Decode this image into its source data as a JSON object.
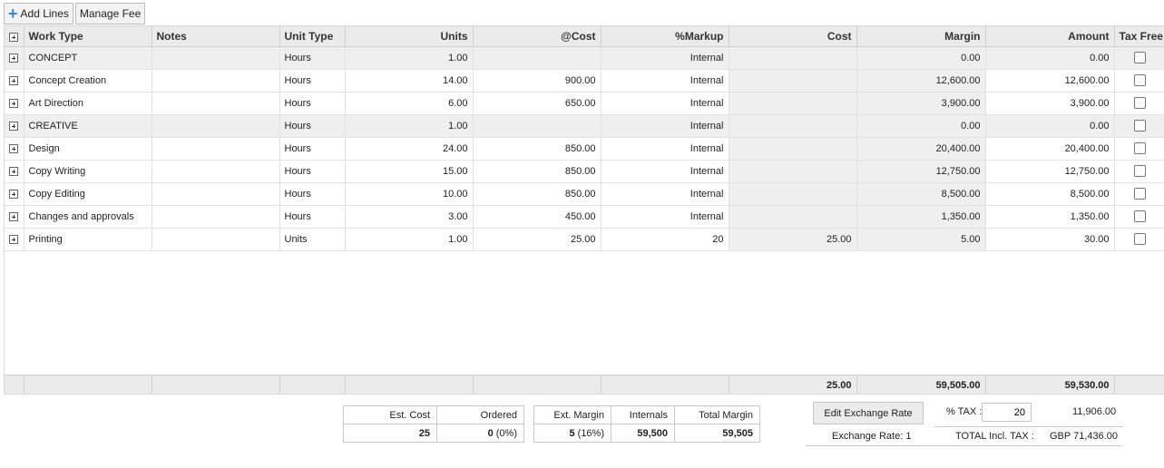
{
  "toolbar": {
    "add_lines": "Add Lines",
    "manage_fee": "Manage Fee"
  },
  "columns": [
    "Work Type",
    "Notes",
    "Unit Type",
    "Units",
    "@Cost",
    "%Markup",
    "Cost",
    "Margin",
    "Amount",
    "Tax Free"
  ],
  "rows": [
    {
      "work_type": "CONCEPT",
      "notes": "",
      "unit_type": "Hours",
      "units": "1.00",
      "at_cost": "",
      "markup": "Internal",
      "cost": "",
      "margin": "0.00",
      "amount": "0.00",
      "tax_free": false
    },
    {
      "work_type": "Concept Creation",
      "notes": "",
      "unit_type": "Hours",
      "units": "14.00",
      "at_cost": "900.00",
      "markup": "Internal",
      "cost": "",
      "margin": "12,600.00",
      "amount": "12,600.00",
      "tax_free": false
    },
    {
      "work_type": "Art Direction",
      "notes": "",
      "unit_type": "Hours",
      "units": "6.00",
      "at_cost": "650.00",
      "markup": "Internal",
      "cost": "",
      "margin": "3,900.00",
      "amount": "3,900.00",
      "tax_free": false
    },
    {
      "work_type": "CREATIVE",
      "notes": "",
      "unit_type": "Hours",
      "units": "1.00",
      "at_cost": "",
      "markup": "Internal",
      "cost": "",
      "margin": "0.00",
      "amount": "0.00",
      "tax_free": false
    },
    {
      "work_type": "Design",
      "notes": "",
      "unit_type": "Hours",
      "units": "24.00",
      "at_cost": "850.00",
      "markup": "Internal",
      "cost": "",
      "margin": "20,400.00",
      "amount": "20,400.00",
      "tax_free": false
    },
    {
      "work_type": "Copy Writing",
      "notes": "",
      "unit_type": "Hours",
      "units": "15.00",
      "at_cost": "850.00",
      "markup": "Internal",
      "cost": "",
      "margin": "12,750.00",
      "amount": "12,750.00",
      "tax_free": false
    },
    {
      "work_type": "Copy Editing",
      "notes": "",
      "unit_type": "Hours",
      "units": "10.00",
      "at_cost": "850.00",
      "markup": "Internal",
      "cost": "",
      "margin": "8,500.00",
      "amount": "8,500.00",
      "tax_free": false
    },
    {
      "work_type": "Changes and approvals",
      "notes": "",
      "unit_type": "Hours",
      "units": "3.00",
      "at_cost": "450.00",
      "markup": "Internal",
      "cost": "",
      "margin": "1,350.00",
      "amount": "1,350.00",
      "tax_free": false
    },
    {
      "work_type": "Printing",
      "notes": "",
      "unit_type": "Units",
      "units": "1.00",
      "at_cost": "25.00",
      "markup": "20",
      "cost": "25.00",
      "margin": "5.00",
      "amount": "30.00",
      "tax_free": false
    }
  ],
  "totals": {
    "cost": "25.00",
    "margin": "59,505.00",
    "amount": "59,530.00"
  },
  "summary": {
    "est_cost_label": "Est. Cost",
    "est_cost": "25",
    "ordered_label": "Ordered",
    "ordered_value": "0",
    "ordered_pct": "(0%)",
    "ext_margin_label": "Ext. Margin",
    "ext_margin_value": "5",
    "ext_margin_pct": "(16%)",
    "internals_label": "Internals",
    "internals": "59,500",
    "total_margin_label": "Total Margin",
    "total_margin": "59,505"
  },
  "exchange": {
    "edit_button": "Edit Exchange Rate",
    "rate_label": "Exchange Rate: 1"
  },
  "tax": {
    "label": "% TAX :",
    "rate": "20",
    "amount": "11,906.00",
    "total_label": "TOTAL Incl. TAX :",
    "total_value": "GBP 71,436.00"
  }
}
